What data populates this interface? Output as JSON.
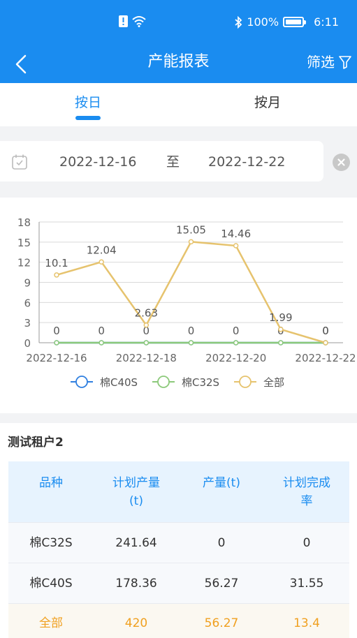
{
  "status_bar": {
    "battery": "100%",
    "time": "6:11"
  },
  "navbar": {
    "title": "产能报表",
    "filter_label": "筛选"
  },
  "tabs": [
    {
      "label": "按日",
      "active": true
    },
    {
      "label": "按月",
      "active": false
    }
  ],
  "date_range": {
    "start": "2022-12-16",
    "separator": "至",
    "end": "2022-12-22"
  },
  "chart_data": {
    "type": "line",
    "x": [
      "2022-12-16",
      "2022-12-17",
      "2022-12-18",
      "2022-12-19",
      "2022-12-20",
      "2022-12-21",
      "2022-12-22"
    ],
    "x_tick_labels": [
      "2022-12-16",
      "2022-12-18",
      "2022-12-20",
      "2022-12-22"
    ],
    "ylim": [
      0,
      18
    ],
    "y_ticks": [
      0,
      3,
      6,
      9,
      12,
      15,
      18
    ],
    "grid": true,
    "legend_position": "bottom",
    "series": [
      {
        "name": "棉C40S",
        "color": "#2f7fe0",
        "values": [
          0,
          0,
          0,
          0,
          0,
          0,
          0
        ],
        "show_labels": false
      },
      {
        "name": "棉C32S",
        "color": "#8cc97a",
        "values": [
          0,
          0,
          0,
          0,
          0,
          0,
          0
        ],
        "show_labels": true
      },
      {
        "name": "全部",
        "color": "#e6c36e",
        "values": [
          10.1,
          12.04,
          2.63,
          15.05,
          14.46,
          1.99,
          0
        ],
        "show_labels": true
      }
    ]
  },
  "report": {
    "tenant": "测试租户2",
    "headers": [
      "品种",
      "计划产量\n(t)",
      "产量(t)",
      "计划完成\n率"
    ],
    "rows": [
      [
        "棉C32S",
        "241.64",
        "0",
        "0"
      ],
      [
        "棉C40S",
        "178.36",
        "56.27",
        "31.55"
      ]
    ],
    "total": [
      "全部",
      "420",
      "56.27",
      "13.4"
    ]
  }
}
